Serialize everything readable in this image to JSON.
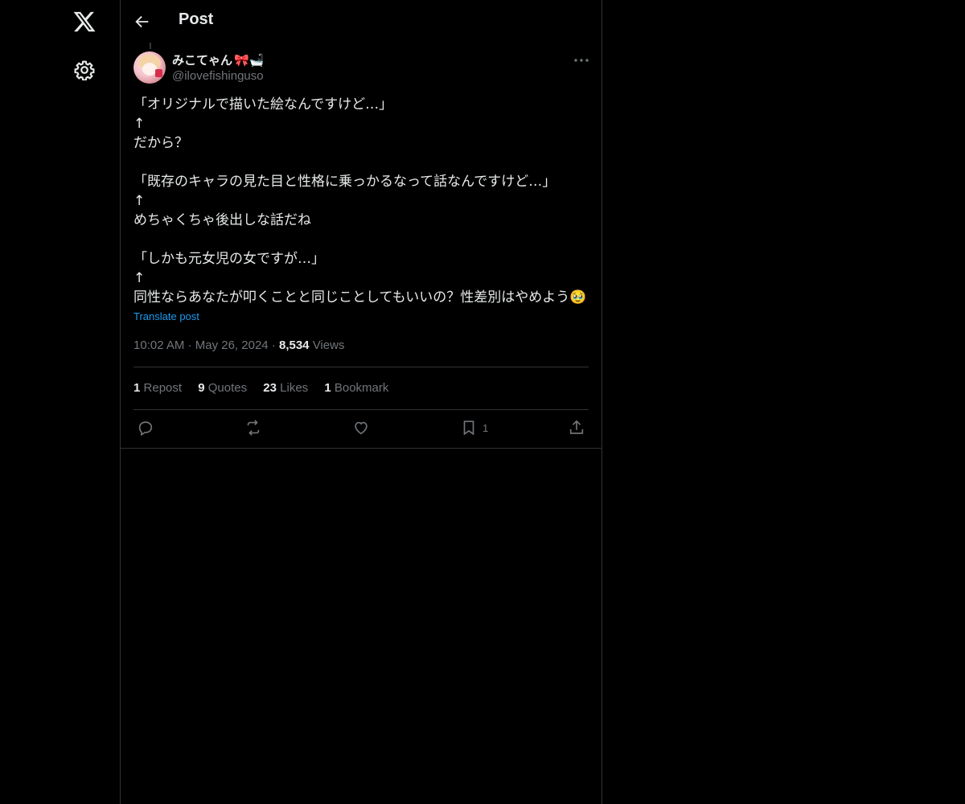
{
  "header": {
    "title": "Post"
  },
  "author": {
    "name": "みこてゃん",
    "name_emoji": "🎀🛁",
    "handle": "@ilovefishinguso"
  },
  "post": {
    "lines": [
      "「オリジナルで描いた絵なんですけど…」",
      "↑",
      "だから？",
      "",
      "「既存のキャラの見た目と性格に乗っかるなって話なんですけど…」",
      "↑",
      "めちゃくちゃ後出しな話だね",
      "",
      "「しかも元女児の女ですが…」",
      "↑",
      "同性ならあなたが叩くことと同じことしてもいいの？性差別はやめよう🥹"
    ],
    "translate_label": "Translate post",
    "time": "10:02 AM",
    "date": "May 26, 2024",
    "views_count": "8,534",
    "views_label": "Views"
  },
  "stats": {
    "reposts_count": "1",
    "reposts_label": "Repost",
    "quotes_count": "9",
    "quotes_label": "Quotes",
    "likes_count": "23",
    "likes_label": "Likes",
    "bookmarks_count": "1",
    "bookmarks_label": "Bookmark"
  },
  "actions": {
    "bookmark_count": "1"
  },
  "icons": {
    "logo": "x-logo-icon",
    "settings": "gear-icon",
    "back": "back-arrow-icon",
    "more": "more-icon",
    "reply": "reply-icon",
    "repost": "repost-icon",
    "like": "heart-icon",
    "bookmark": "bookmark-icon",
    "share": "share-icon"
  },
  "colors": {
    "background": "#000000",
    "text": "#e7e9ea",
    "muted": "#71767b",
    "accent": "#1d9bf0",
    "border": "#2f3336"
  }
}
